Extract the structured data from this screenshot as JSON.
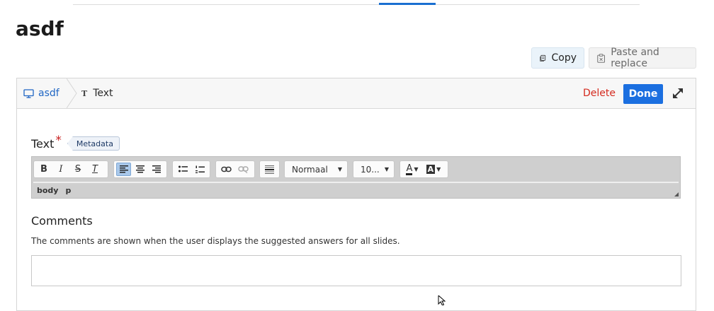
{
  "page": {
    "title": "asdf"
  },
  "actions": {
    "copy_label": "Copy",
    "paste_label": "Paste and replace"
  },
  "panel": {
    "breadcrumb_root": "asdf",
    "breadcrumb_current": "Text",
    "type_glyph": "T",
    "delete_label": "Delete",
    "done_label": "Done"
  },
  "text_field": {
    "label": "Text",
    "required_marker": "*",
    "metadata_tag": "Metadata",
    "editor": {
      "format_select": "Normaal",
      "size_select": "10...",
      "element_path": [
        "body",
        "p"
      ],
      "buttons": {
        "bold": "B",
        "italic": "I",
        "strike": "S",
        "clear": "T",
        "text_color": "A",
        "bg_color": "A"
      }
    }
  },
  "comments": {
    "label": "Comments",
    "help": "The comments are shown when the user displays the suggested answers for all slides.",
    "value": ""
  },
  "colors": {
    "accent": "#1b6fe0",
    "danger": "#d42a1e",
    "link": "#1f66c4"
  }
}
